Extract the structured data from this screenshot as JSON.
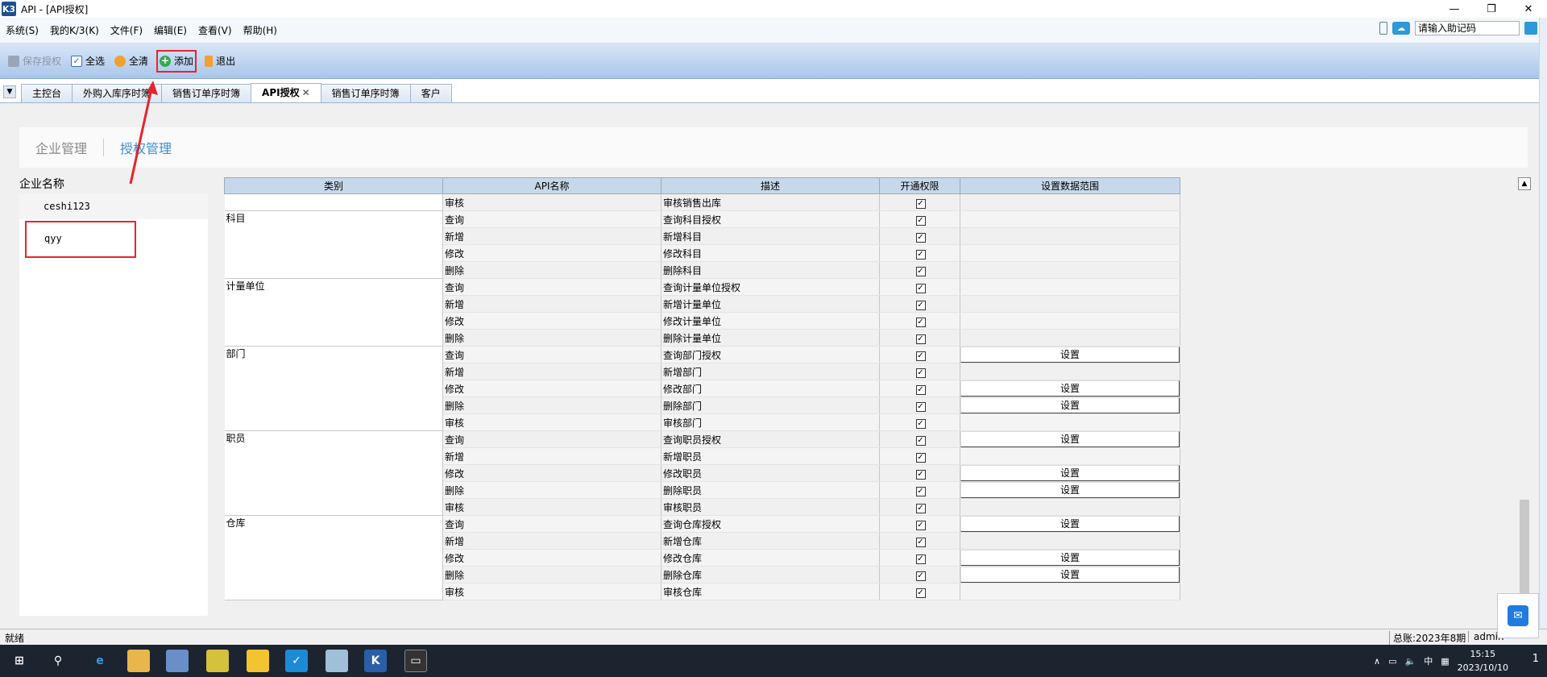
{
  "window": {
    "title": "API - [API授权]",
    "logo": "K3"
  },
  "menu": {
    "items": [
      "系统(S)",
      "我的K/3(K)",
      "文件(F)",
      "编辑(E)",
      "查看(V)",
      "帮助(H)"
    ],
    "search_placeholder": "请输入助记码"
  },
  "toolbar": {
    "save_label": "保存授权",
    "select_all_label": "全选",
    "clear_label": "全清",
    "add_label": "添加",
    "exit_label": "退出"
  },
  "tabs": [
    "主控台",
    "外购入库序时簿",
    "销售订单序时簿",
    "API授权",
    "销售订单序时簿",
    "客户"
  ],
  "breadcrumbs": {
    "company": "企业管理",
    "auth": "授权管理"
  },
  "left_panel": {
    "header": "企业名称",
    "companies": [
      "ceshi123",
      "qyy"
    ]
  },
  "grid": {
    "headers": [
      "类别",
      "API名称",
      "描述",
      "开通权限",
      "设置数据范围"
    ],
    "set_label": "设置",
    "groups": [
      {
        "category": "",
        "rows": [
          {
            "api": "审核",
            "desc": "审核销售出库",
            "checked": true,
            "set": false
          }
        ]
      },
      {
        "category": "科目",
        "rows": [
          {
            "api": "查询",
            "desc": "查询科目授权",
            "checked": true,
            "set": false
          },
          {
            "api": "新增",
            "desc": "新增科目",
            "checked": true,
            "set": false
          },
          {
            "api": "修改",
            "desc": "修改科目",
            "checked": true,
            "set": false
          },
          {
            "api": "删除",
            "desc": "删除科目",
            "checked": true,
            "set": false
          }
        ]
      },
      {
        "category": "计量单位",
        "rows": [
          {
            "api": "查询",
            "desc": "查询计量单位授权",
            "checked": true,
            "set": false
          },
          {
            "api": "新增",
            "desc": "新增计量单位",
            "checked": true,
            "set": false
          },
          {
            "api": "修改",
            "desc": "修改计量单位",
            "checked": true,
            "set": false
          },
          {
            "api": "删除",
            "desc": "删除计量单位",
            "checked": true,
            "set": false
          }
        ]
      },
      {
        "category": "部门",
        "rows": [
          {
            "api": "查询",
            "desc": "查询部门授权",
            "checked": true,
            "set": true
          },
          {
            "api": "新增",
            "desc": "新增部门",
            "checked": true,
            "set": false
          },
          {
            "api": "修改",
            "desc": "修改部门",
            "checked": true,
            "set": true
          },
          {
            "api": "删除",
            "desc": "删除部门",
            "checked": true,
            "set": true
          },
          {
            "api": "审核",
            "desc": "审核部门",
            "checked": true,
            "set": false
          }
        ]
      },
      {
        "category": "职员",
        "rows": [
          {
            "api": "查询",
            "desc": "查询职员授权",
            "checked": true,
            "set": true
          },
          {
            "api": "新增",
            "desc": "新增职员",
            "checked": true,
            "set": false
          },
          {
            "api": "修改",
            "desc": "修改职员",
            "checked": true,
            "set": true
          },
          {
            "api": "删除",
            "desc": "删除职员",
            "checked": true,
            "set": true
          },
          {
            "api": "审核",
            "desc": "审核职员",
            "checked": true,
            "set": false
          }
        ]
      },
      {
        "category": "仓库",
        "rows": [
          {
            "api": "查询",
            "desc": "查询仓库授权",
            "checked": true,
            "set": true
          },
          {
            "api": "新增",
            "desc": "新增仓库",
            "checked": true,
            "set": false
          },
          {
            "api": "修改",
            "desc": "修改仓库",
            "checked": true,
            "set": true
          },
          {
            "api": "删除",
            "desc": "删除仓库",
            "checked": true,
            "set": true
          },
          {
            "api": "审核",
            "desc": "审核仓库",
            "checked": true,
            "set": false
          }
        ]
      }
    ]
  },
  "status": {
    "ready": "就绪",
    "period": "总账:2023年8期",
    "user": "admin"
  },
  "taskbar": {
    "time": "15:15",
    "date": "2023/10/10",
    "ime": "中",
    "notification_count": "1"
  },
  "colors": {
    "accent": "#3c8fd8",
    "highlight": "#e6252a",
    "toolbar": "#a9c6ea"
  }
}
